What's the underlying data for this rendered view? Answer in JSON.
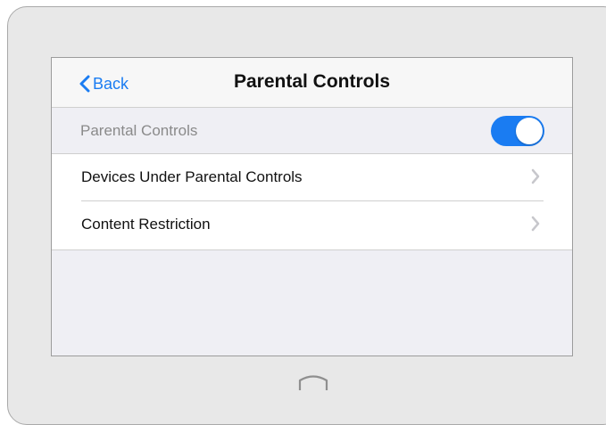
{
  "nav": {
    "back_label": "Back",
    "title": "Parental Controls"
  },
  "toggle": {
    "label": "Parental Controls",
    "enabled": true
  },
  "list": {
    "items": [
      {
        "label": "Devices Under Parental Controls",
        "icon": "chevron-right-icon"
      },
      {
        "label": "Content Restriction",
        "icon": "chevron-right-icon"
      }
    ]
  },
  "icons": {
    "back": "chevron-left-icon",
    "home": "home-button-icon"
  },
  "colors": {
    "accent": "#1a7cf2",
    "navbar_bg": "#f7f7f7",
    "screen_bg": "#efeff4",
    "device_frame": "#e8e8e8",
    "chevron": "#c7c7cc"
  }
}
